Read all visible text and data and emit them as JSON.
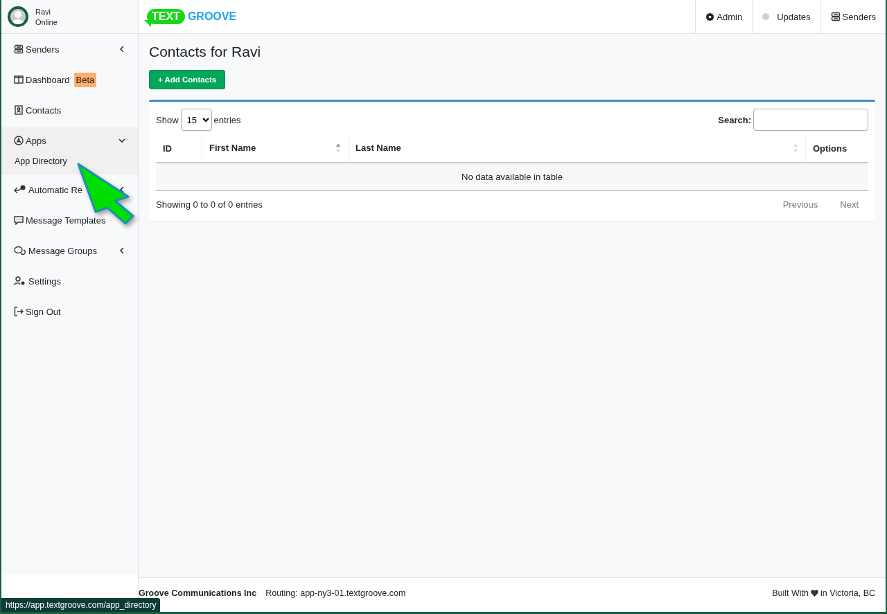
{
  "user": {
    "name": "Ravi",
    "status": "Online"
  },
  "logo": {
    "part_1": "TEXT",
    "part_2": "GROOVE"
  },
  "top_nav": [
    {
      "kind": "gear",
      "label": "Admin"
    },
    {
      "kind": "dot",
      "label": "Updates"
    },
    {
      "kind": "tray",
      "label": "Senders"
    }
  ],
  "sidebar": {
    "items": [
      {
        "kind": "tray",
        "label": "Senders",
        "expanded": false
      },
      {
        "kind": "columns",
        "label": "Dashboard",
        "badge": "Beta"
      },
      {
        "kind": "contact",
        "label": "Contacts"
      },
      {
        "kind": "apps",
        "label": "Apps",
        "expanded": true,
        "children": [
          {
            "label": "App Directory"
          }
        ]
      },
      {
        "kind": "reply",
        "label": "Automatic Re",
        "expanded": false
      },
      {
        "kind": "chat",
        "label": "Message Templates"
      },
      {
        "kind": "chats",
        "label": "Message Groups",
        "expanded": false
      },
      {
        "kind": "usergear",
        "label": "Settings"
      },
      {
        "kind": "signout",
        "label": "Sign Out"
      }
    ]
  },
  "page": {
    "title": "Contacts for Ravi",
    "add_button": "+ Add Contacts"
  },
  "table_controls": {
    "show_label": "Show",
    "page_size": "15",
    "entries_label": "entries",
    "search_label": "Search:"
  },
  "table": {
    "columns": [
      {
        "kind": "plain",
        "label": "ID"
      },
      {
        "kind": "sortable",
        "label": "First Name",
        "sorted": true
      },
      {
        "kind": "sortable",
        "label": "Last Name",
        "sorted": false
      },
      {
        "kind": "plain",
        "label": "Options"
      }
    ],
    "empty_message": "No data available in table"
  },
  "table_info": "Showing 0 to 0 of 0 entries",
  "pagination": [
    {
      "label": "Previous",
      "disabled": true
    },
    {
      "label": "Next",
      "disabled": true
    }
  ],
  "footer": {
    "company": "Groove Communications Inc",
    "routing": "Routing: app-ny3-01.textgroove.com",
    "built_with": "Built With",
    "built_place": "in Victoria, BC"
  },
  "status_bar": {
    "link_url": "https://app.textgroove.com/app_directory"
  }
}
